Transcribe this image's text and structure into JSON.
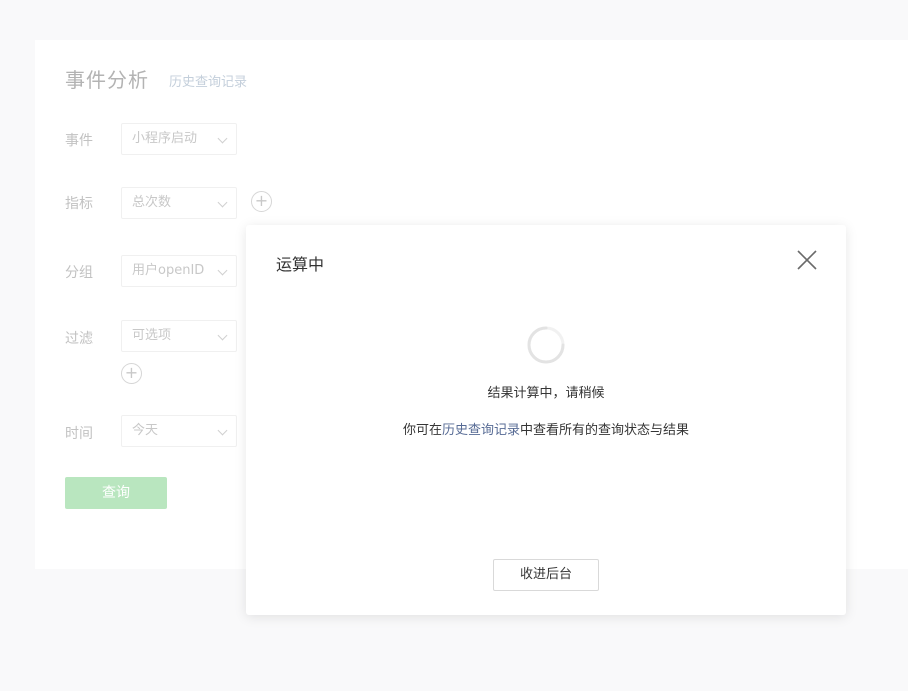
{
  "form": {
    "title": "事件分析",
    "history_link": "历史查询记录",
    "rows": [
      {
        "label": "事件",
        "value": "小程序启动"
      },
      {
        "label": "指标",
        "value": "总次数"
      },
      {
        "label": "分组",
        "value": "用户openID"
      },
      {
        "label": "过滤",
        "value": "可选项"
      },
      {
        "label": "时间",
        "value": "今天"
      }
    ],
    "add_symbol": "+",
    "query_label": "查询"
  },
  "modal": {
    "title": "运算中",
    "message": "结果计算中，请稍候",
    "hint_prefix": "你可在",
    "hint_link": "历史查询记录",
    "hint_suffix": "中查看所有的查询状态与结果",
    "background_label": "收进后台"
  },
  "colors": {
    "accent_disabled": "#b9e6bf",
    "link": "#576b95",
    "spinner": "#e3e3e3"
  },
  "icons": {
    "close": "close-icon",
    "spinner": "loading-spinner-icon",
    "add": "plus-circle-icon",
    "dropdown": "chevron-down-icon"
  }
}
